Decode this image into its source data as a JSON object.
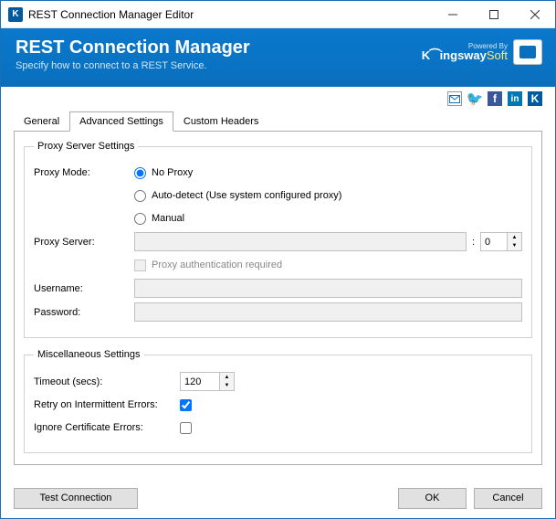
{
  "window": {
    "title": "REST Connection Manager Editor"
  },
  "header": {
    "title": "REST Connection Manager",
    "subtitle": "Specify how to connect to a REST Service.",
    "powered": "Powered By",
    "brand_k": "K⁀ingsway",
    "brand_soft": "Soft"
  },
  "tabs": {
    "items": [
      {
        "label": "General"
      },
      {
        "label": "Advanced Settings"
      },
      {
        "label": "Custom Headers"
      }
    ],
    "active_index": 1
  },
  "proxy": {
    "legend": "Proxy Server Settings",
    "mode_label": "Proxy Mode:",
    "options": {
      "no_proxy": "No Proxy",
      "auto": "Auto-detect (Use system configured proxy)",
      "manual": "Manual"
    },
    "selected": "no_proxy",
    "server_label": "Proxy Server:",
    "server_value": "",
    "port_value": "0",
    "auth_label": "Proxy authentication required",
    "auth_checked": false,
    "username_label": "Username:",
    "username_value": "",
    "password_label": "Password:",
    "password_value": ""
  },
  "misc": {
    "legend": "Miscellaneous Settings",
    "timeout_label": "Timeout (secs):",
    "timeout_value": "120",
    "retry_label": "Retry on Intermittent Errors:",
    "retry_checked": true,
    "ignore_cert_label": "Ignore Certificate Errors:",
    "ignore_cert_checked": false
  },
  "footer": {
    "test": "Test Connection",
    "ok": "OK",
    "cancel": "Cancel"
  }
}
